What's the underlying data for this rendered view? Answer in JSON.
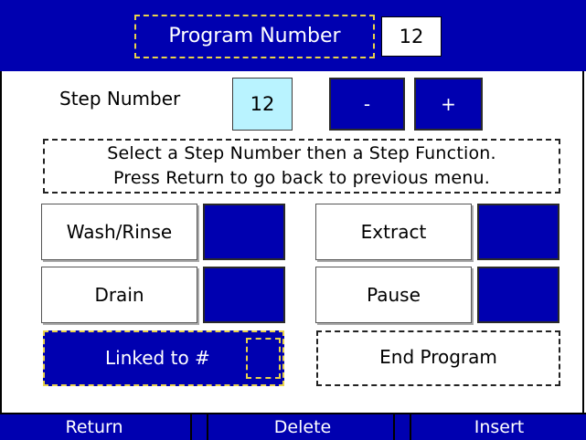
{
  "header": {
    "program_label": "Program Number",
    "program_value": "12"
  },
  "step": {
    "label": "Step Number",
    "value": "12",
    "minus_label": "-",
    "plus_label": "+"
  },
  "instructions": {
    "line1": "Select a Step Number then a Step Function.",
    "line2": "Press Return to go back to previous menu."
  },
  "functions": {
    "wash_rinse": "Wash/Rinse",
    "drain": "Drain",
    "extract": "Extract",
    "pause": "Pause",
    "linked_to": "Linked to #",
    "end_program": "End Program"
  },
  "footer": {
    "return": "Return",
    "delete": "Delete",
    "insert": "Insert"
  },
  "colors": {
    "primary_blue": "#0000b0",
    "highlight_yellow": "#e8d24a",
    "field_cyan": "#b9f3ff"
  }
}
